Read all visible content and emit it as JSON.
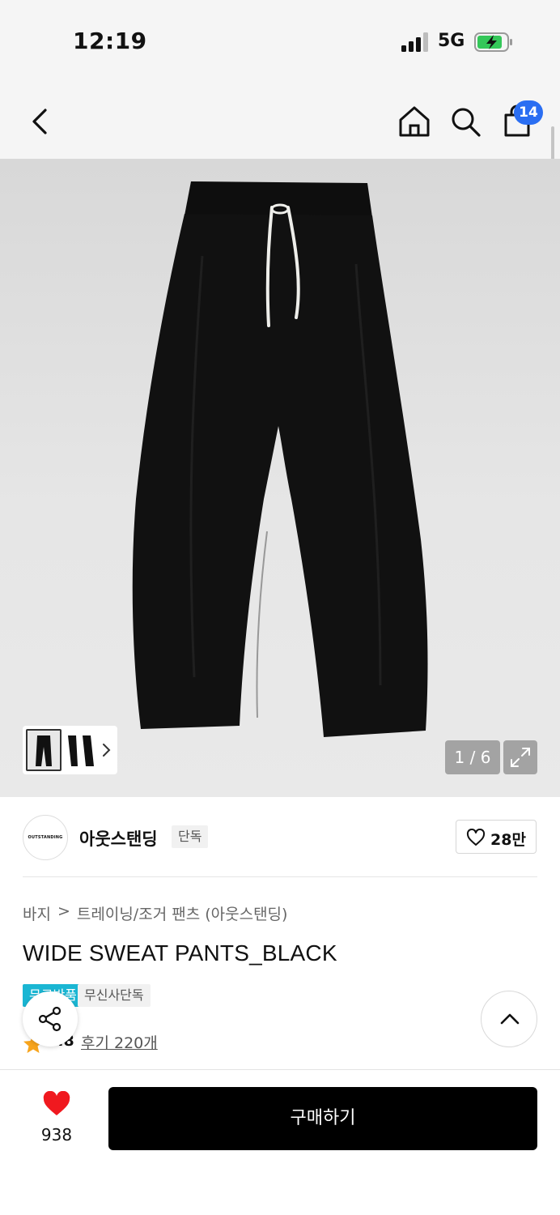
{
  "status_bar": {
    "time": "12:19",
    "network": "5G"
  },
  "nav": {
    "cart_count": "14"
  },
  "gallery": {
    "pager": "1 / 6"
  },
  "brand": {
    "logo_text": "OUTSTANDING",
    "name": "아웃스탠딩",
    "tag": "단독",
    "like_count": "28만"
  },
  "product": {
    "breadcrumb": {
      "category": "바지",
      "separator": ">",
      "subcategory": "트레이닝/조거 팬츠 (아웃스탠딩)"
    },
    "title": "WIDE SWEAT PANTS_BLACK",
    "tags": {
      "free": "무료반품",
      "exclusive": "무신사단독"
    },
    "rating": "4.8",
    "review_link": "후기 220개"
  },
  "bottom_bar": {
    "wish_count": "938",
    "buy_label": "구매하기"
  },
  "colors": {
    "accent_blue": "#2a6ef2",
    "tag_cyan": "#1ab6d3",
    "heart_red": "#f0191f",
    "star_orange": "#f7a41c",
    "buy_black": "#000000"
  }
}
